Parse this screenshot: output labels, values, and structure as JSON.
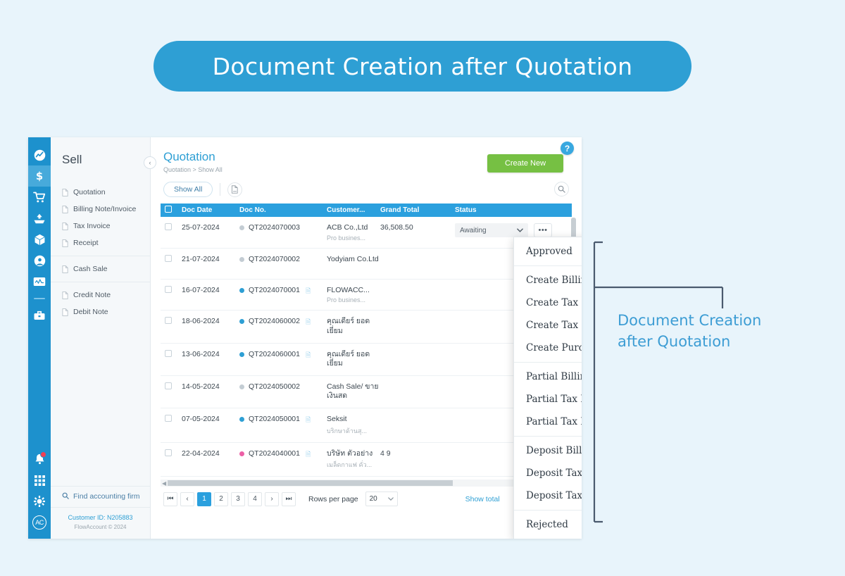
{
  "banner": {
    "title": "Document Creation after Quotation",
    "bg": "#2e9fd4"
  },
  "rail": {
    "items": [
      {
        "name": "dashboard-icon",
        "active": false
      },
      {
        "name": "sell-icon",
        "active": true
      },
      {
        "name": "buy-cart-icon",
        "active": false
      },
      {
        "name": "expense-icon",
        "active": false
      },
      {
        "name": "products-box-icon",
        "active": false
      },
      {
        "name": "payroll-icon",
        "active": false
      },
      {
        "name": "reports-icon",
        "active": false
      },
      {
        "name": "assets-icon",
        "active": false
      }
    ],
    "bottom": [
      {
        "name": "notifications-bell-icon"
      },
      {
        "name": "apps-grid-icon"
      },
      {
        "name": "settings-gear-icon"
      },
      {
        "name": "account-avatar",
        "label": "AC"
      }
    ]
  },
  "sidebar": {
    "title": "Sell",
    "collapse_icon": "‹",
    "groups": [
      {
        "items": [
          {
            "label": "Quotation"
          },
          {
            "label": "Billing Note/Invoice"
          },
          {
            "label": "Tax Invoice"
          },
          {
            "label": "Receipt"
          }
        ]
      },
      {
        "items": [
          {
            "label": "Cash Sale"
          }
        ]
      },
      {
        "items": [
          {
            "label": "Credit Note"
          },
          {
            "label": "Debit Note"
          }
        ]
      }
    ],
    "find_firm": "Find accounting firm",
    "footer": {
      "customer_id_label": "Customer ID:",
      "customer_id_value": "N205883",
      "copyright": "FlowAccount © 2024"
    }
  },
  "main": {
    "page_title": "Quotation",
    "breadcrumb": "Quotation > Show All",
    "create_new": "Create New",
    "help_label": "?",
    "filter_chip": "Show All",
    "export_icon": "document-export-icon",
    "search_icon": "search-icon"
  },
  "table": {
    "columns": [
      "Doc Date",
      "Doc No.",
      "Customer...",
      "Grand Total",
      "Status"
    ],
    "rows": [
      {
        "date": "25-07-2024",
        "dot": "grey",
        "doc_no": "QT2024070003",
        "attach": false,
        "customer": "ACB Co.,Ltd",
        "customer_sub": "Pro busines...",
        "total": "36,508.50",
        "status": "Awaiting"
      },
      {
        "date": "21-07-2024",
        "dot": "grey",
        "doc_no": "QT2024070002",
        "attach": false,
        "customer": "Yodyiam Co.Ltd",
        "customer_sub": "",
        "total": "",
        "status": ""
      },
      {
        "date": "16-07-2024",
        "dot": "blue",
        "doc_no": "QT2024070001",
        "attach": true,
        "customer": "FLOWACC...",
        "customer_sub": "Pro busines...",
        "total": "",
        "status": ""
      },
      {
        "date": "18-06-2024",
        "dot": "blue",
        "doc_no": "QT2024060002",
        "attach": true,
        "customer": "คุณเดียร์ ยอดเยี่ยม",
        "customer_sub": "",
        "total": "",
        "status": ""
      },
      {
        "date": "13-06-2024",
        "dot": "blue",
        "doc_no": "QT2024060001",
        "attach": true,
        "customer": "คุณเดียร์ ยอดเยี่ยม",
        "customer_sub": "",
        "total": "",
        "status": ""
      },
      {
        "date": "14-05-2024",
        "dot": "grey",
        "doc_no": "QT2024050002",
        "attach": false,
        "customer": "Cash Sale/ ขายเงินสด",
        "customer_sub": "",
        "total": "",
        "status": ""
      },
      {
        "date": "07-05-2024",
        "dot": "blue",
        "doc_no": "QT2024050001",
        "attach": true,
        "customer": "Seksit",
        "customer_sub": "บริกษาด้านสุ...",
        "total": "",
        "status": ""
      },
      {
        "date": "22-04-2024",
        "dot": "pink",
        "doc_no": "QT2024040001",
        "attach": true,
        "customer": "บริษัท ตัวอย่าง",
        "customer_sub": "เมล็ดกาแฟ คั่ว...",
        "total": "4 9",
        "status": ""
      }
    ],
    "status_dropdown_value": "Awaiting",
    "row_actions_icon": "•••"
  },
  "pagination": {
    "first": "⏮",
    "prev": "‹",
    "pages": [
      "1",
      "2",
      "3",
      "4"
    ],
    "active_page": "1",
    "next": "›",
    "last": "⏭",
    "rows_per_page_label": "Rows per page",
    "rows_per_page_value": "20",
    "show_total": "Show total"
  },
  "dropdown_menu": {
    "groups": [
      {
        "items": [
          "Approved"
        ]
      },
      {
        "items": [
          "Create Billing Note/Invoice",
          "Create Tax Invoice",
          "Create Tax Invoice/Receipt (Cash)",
          "Create Purchase Order"
        ]
      },
      {
        "items": [
          "Partial Billing Note/Invoice",
          "Partial Tax Invoice",
          "Partial Tax Invoice/Receipt (Cash)"
        ]
      },
      {
        "items": [
          "Deposit Billing Note/Invoice",
          "Deposit Tax Invoice",
          "Deposit Tax Invoice/Receipt (Cash)"
        ]
      },
      {
        "items": [
          "Rejected"
        ]
      }
    ]
  },
  "annotation": {
    "line1": "Document Creation",
    "line2": "after Quotation",
    "color": "#3d9dd4",
    "bracket_color": "#4a5a6e"
  }
}
